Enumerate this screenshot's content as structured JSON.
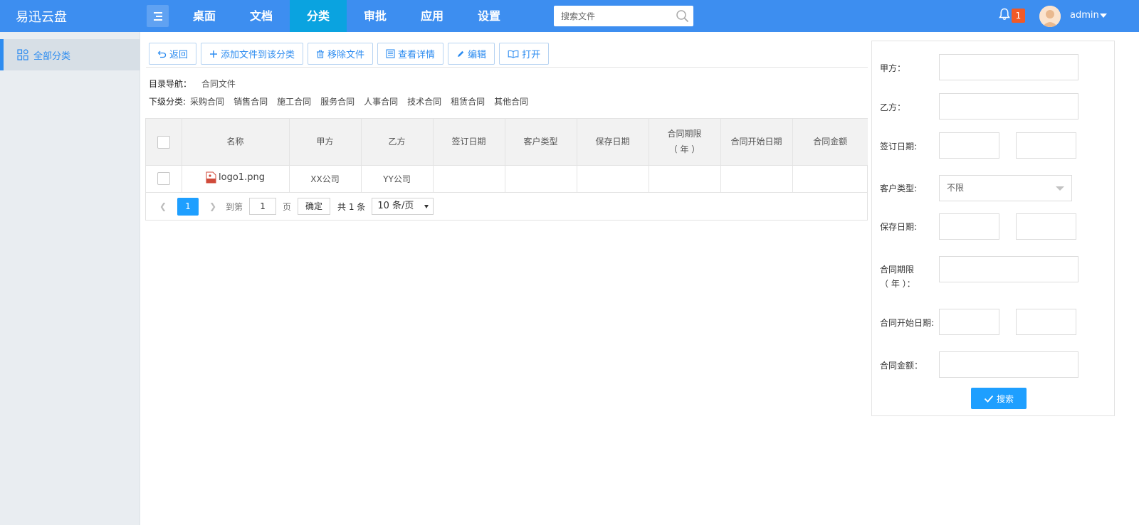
{
  "app": {
    "title": "易迅云盘"
  },
  "nav": {
    "items": [
      {
        "label": "桌面"
      },
      {
        "label": "文档"
      },
      {
        "label": "分类",
        "active": true
      },
      {
        "label": "审批"
      },
      {
        "label": "应用"
      },
      {
        "label": "设置"
      }
    ]
  },
  "search": {
    "placeholder": "搜索文件",
    "value": ""
  },
  "notifications": {
    "count": "1"
  },
  "user": {
    "name": "admin"
  },
  "sidebar": {
    "items": [
      {
        "label": "全部分类",
        "icon": "grid-icon",
        "active": true
      }
    ]
  },
  "toolbar": {
    "back": "返回",
    "add": "添加文件到该分类",
    "remove": "移除文件",
    "details": "查看详情",
    "edit": "编辑",
    "open": "打开"
  },
  "breadcrumb": {
    "label": "目录导航：",
    "value": "合同文件"
  },
  "subcategories": {
    "label": "下级分类:",
    "items": [
      "采购合同",
      "销售合同",
      "施工合同",
      "服务合同",
      "人事合同",
      "技术合同",
      "租赁合同",
      "其他合同"
    ]
  },
  "table": {
    "headers": {
      "name": "名称",
      "party_a": "甲方",
      "party_b": "乙方",
      "sign_date": "签订日期",
      "customer_type": "客户类型",
      "save_date": "保存日期",
      "term_line1": "合同期限",
      "term_line2": "（ 年 ）",
      "start_date": "合同开始日期",
      "amount": "合同金额"
    },
    "rows": [
      {
        "name": "logo1.png",
        "file_type": "PNG",
        "party_a": "XX公司",
        "party_b": "YY公司",
        "sign_date": "",
        "customer_type": "",
        "save_date": "",
        "term": "",
        "start_date": "",
        "amount": ""
      }
    ]
  },
  "pagination": {
    "current": "1",
    "goto_label": "到第",
    "goto_value": "1",
    "page_unit": "页",
    "confirm": "确定",
    "total": "共 1 条",
    "page_size": "10 条/页"
  },
  "filter": {
    "party_a_label": "甲方：",
    "party_b_label": "乙方：",
    "sign_date_label": "签订日期:",
    "customer_type_label": "客户类型:",
    "customer_type_value": "不限",
    "save_date_label": "保存日期:",
    "term_label_line1": "合同期限",
    "term_label_line2": "（ 年 ）：",
    "start_date_label": "合同开始日期:",
    "amount_label": "合同金额：",
    "search_button": "搜索"
  },
  "colors": {
    "header_bg": "#3d8ef0",
    "nav_active": "#0aa3e0",
    "primary": "#1e9fff",
    "badge": "#f05a28"
  }
}
